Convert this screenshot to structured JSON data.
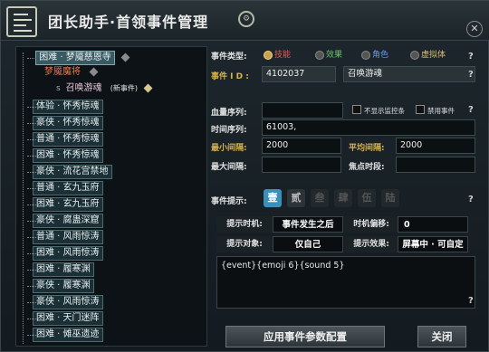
{
  "window": {
    "title": "团长助手·首领事件管理",
    "close_glyph": "✕",
    "gear_glyph": "⚙"
  },
  "tree": {
    "root": "困难 · 梦魇慈恩寺",
    "child": "梦魇魔将",
    "grandchild": "召唤游魂",
    "grandchild_tag": "(新事件)",
    "items": [
      "体验 · 怀秀惊魂",
      "豪侠 · 怀秀惊魂",
      "普通 · 怀秀惊魂",
      "困难 · 怀秀惊魂",
      "豪侠 · 流花宫禁地",
      "普通 · 玄九玉府",
      "困难 · 玄九玉府",
      "豪侠 · 腐蛊深窟",
      "普通 · 风雨惊涛",
      "困难 · 风雨惊涛",
      "困难 · 履寒渊",
      "豪侠 · 履寒渊",
      "豪侠 · 风雨惊涛",
      "困难 · 天门迷阵",
      "困难 · 傩巫遗迹"
    ]
  },
  "event": {
    "type_label": "事件类型:",
    "types": [
      "技能",
      "效果",
      "角色",
      "虚拟体"
    ],
    "id_label": "事件 I D :",
    "id_value": "4102037",
    "name_value": "召唤游魂",
    "blood_label": "血量序列:",
    "blood_value": "",
    "chk1": "不显示监控条",
    "chk2": "禁用事件",
    "time_label": "时间序列:",
    "time_value": "61003,",
    "min_label": "最小间隔:",
    "min_value": "2000",
    "avg_label": "平均间隔:",
    "avg_value": "2000",
    "max_label": "最大间隔:",
    "max_value": "",
    "focus_label": "焦点时段:",
    "focus_value": "",
    "hint_label": "事件提示:",
    "hint_tabs": [
      "壹",
      "贰",
      "叁",
      "肆",
      "伍",
      "陆"
    ],
    "q": "?",
    "t_time_label": "提示时机:",
    "t_time_value": "事件发生之后",
    "t_offset_label": "时机偏移:",
    "t_offset_value": "0",
    "t_target_label": "提示对象:",
    "t_target_value": "仅自己",
    "t_effect_label": "提示效果:",
    "t_effect_value": "屏幕中 · 可自定",
    "text_value": "{event}{emoji 6}{sound 5}",
    "apply_button": "应用事件参数配置",
    "close_button": "关闭"
  }
}
